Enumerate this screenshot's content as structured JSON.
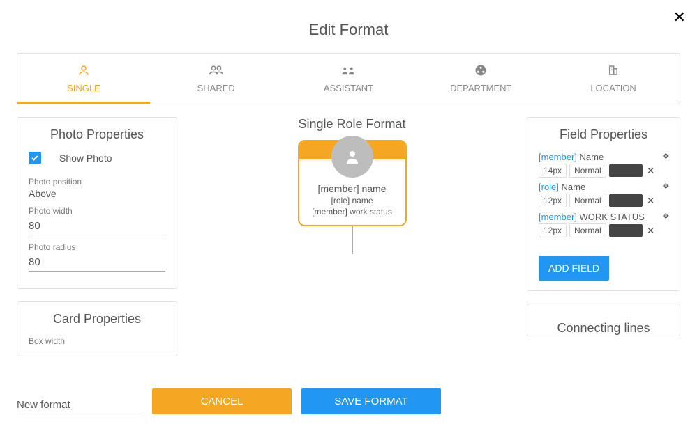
{
  "title": "Edit Format",
  "tabs": [
    {
      "label": "SINGLE",
      "active": true
    },
    {
      "label": "SHARED",
      "active": false
    },
    {
      "label": "ASSISTANT",
      "active": false
    },
    {
      "label": "DEPARTMENT",
      "active": false
    },
    {
      "label": "LOCATION",
      "active": false
    }
  ],
  "photoProperties": {
    "title": "Photo Properties",
    "showPhotoLabel": "Show Photo",
    "showPhotoChecked": true,
    "positionLabel": "Photo position",
    "positionValue": "Above",
    "widthLabel": "Photo width",
    "widthValue": "80",
    "radiusLabel": "Photo radius",
    "radiusValue": "80"
  },
  "cardProperties": {
    "title": "Card Properties",
    "boxWidthLabel": "Box width"
  },
  "preview": {
    "title": "Single Role Format",
    "line1": "[member] name",
    "line2": "[role] name",
    "line3": "[member] work status"
  },
  "fieldProperties": {
    "title": "Field Properties",
    "fields": [
      {
        "tag": "[member]",
        "name": "Name",
        "size": "14px",
        "weight": "Normal",
        "color": "#444444"
      },
      {
        "tag": "[role]",
        "name": "Name",
        "size": "12px",
        "weight": "Normal",
        "color": "#444444"
      },
      {
        "tag": "[member]",
        "name": "WORK STATUS",
        "size": "12px",
        "weight": "Normal",
        "color": "#444444"
      }
    ],
    "addFieldLabel": "ADD FIELD"
  },
  "connectingLines": {
    "title": "Connecting lines"
  },
  "footer": {
    "nameValue": "New format",
    "cancelLabel": "CANCEL",
    "saveLabel": "SAVE FORMAT"
  }
}
